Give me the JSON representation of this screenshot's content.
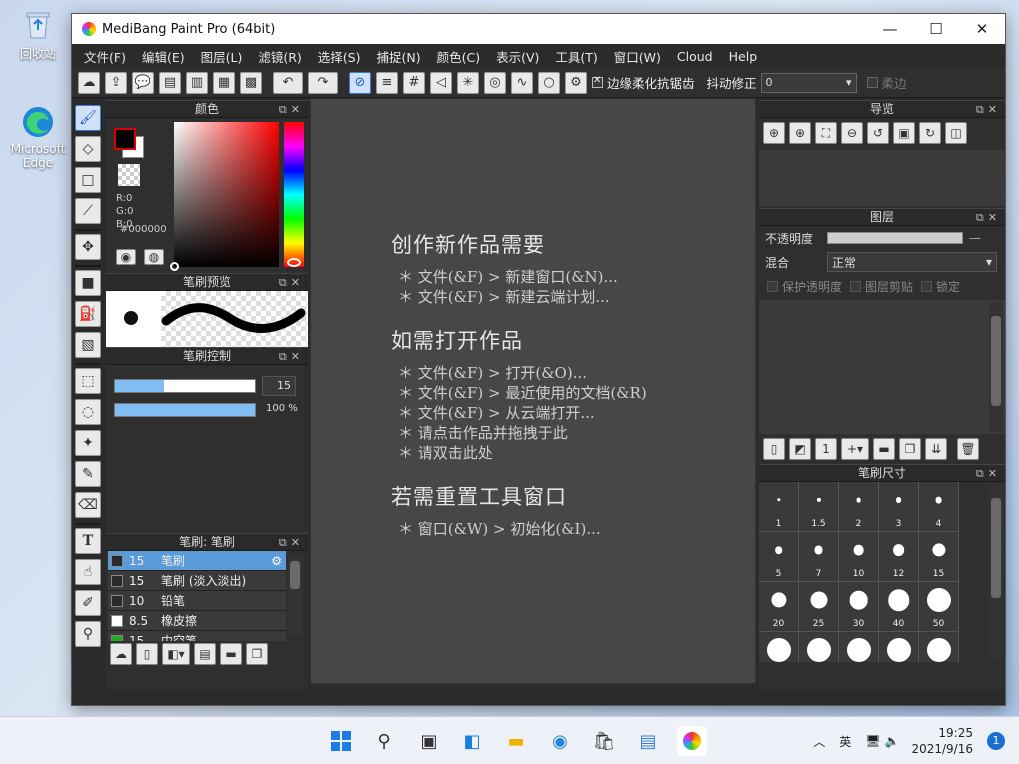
{
  "desktop": {
    "recycle_label": "回收站",
    "edge_label": "Microsoft Edge"
  },
  "window": {
    "title": "MediBang Paint Pro (64bit)",
    "min": "—",
    "max": "☐",
    "close": "✕"
  },
  "menu": [
    "文件(F)",
    "编辑(E)",
    "图层(L)",
    "滤镜(R)",
    "选择(S)",
    "捕捉(N)",
    "颜色(C)",
    "表示(V)",
    "工具(T)",
    "窗口(W)",
    "Cloud",
    "Help"
  ],
  "toolbar": {
    "antialias_label": "边缘柔化抗锯齿",
    "stabilizer_label": "抖动修正",
    "stabilizer_value": "0",
    "soft_label": "柔边"
  },
  "panels": {
    "color": "颜色",
    "brush_preview": "笔刷预览",
    "brush_control": "笔刷控制",
    "brush_list": "笔刷: 笔刷",
    "navigator": "导览",
    "layer": "图层",
    "brush_size": "笔刷尺寸"
  },
  "color": {
    "r": "R:0",
    "g": "G:0",
    "b": "B:0",
    "hex": "#000000",
    "fg": "#000000",
    "bg": "#ffffff"
  },
  "brush_control": {
    "size_value": "15",
    "opacity_value": "100",
    "opacity_unit": "%",
    "size_fraction": 0.35,
    "opacity_fraction": 1.0
  },
  "brush_list": [
    {
      "size": "15",
      "name": "笔刷",
      "color": "#2a2a2a",
      "selected": true
    },
    {
      "size": "15",
      "name": "笔刷 (淡入淡出)",
      "color": "#2a2a2a",
      "selected": false
    },
    {
      "size": "10",
      "name": "铅笔",
      "color": "#2a2a2a",
      "selected": false
    },
    {
      "size": "8.5",
      "name": "橡皮擦",
      "color": "#ffffff",
      "selected": false
    },
    {
      "size": "15",
      "name": "中空笔",
      "color": "#22aa22",
      "selected": false
    }
  ],
  "layer": {
    "opacity_label": "不透明度",
    "blend_label": "混合",
    "blend_value": "正常",
    "protect_alpha": "保护透明度",
    "clipping": "图层剪贴",
    "lock": "锁定"
  },
  "brush_sizes": [
    "1",
    "1.5",
    "2",
    "3",
    "4",
    "5",
    "7",
    "10",
    "12",
    "15",
    "20",
    "25",
    "30",
    "40",
    "50",
    "",
    "",
    "",
    "",
    ""
  ],
  "guide": {
    "h1": "创作新作品需要",
    "g1": [
      "＊ 文件(&F) > 新建窗口(&N)...",
      "＊ 文件(&F) > 新建云端计划..."
    ],
    "h2": "如需打开作品",
    "g2": [
      "＊ 文件(&F) > 打开(&O)...",
      "＊ 文件(&F) > 最近使用的文档(&R)",
      "＊ 文件(&F) > 从云端打开...",
      "＊ 请点击作品并拖拽于此",
      "＊ 请双击此处"
    ],
    "h3": "若需重置工具窗口",
    "g3": [
      "＊ 窗口(&W) > 初始化(&I)..."
    ]
  },
  "tray": {
    "lang": "英",
    "time": "19:25",
    "date": "2021/9/16",
    "badge": "1"
  }
}
